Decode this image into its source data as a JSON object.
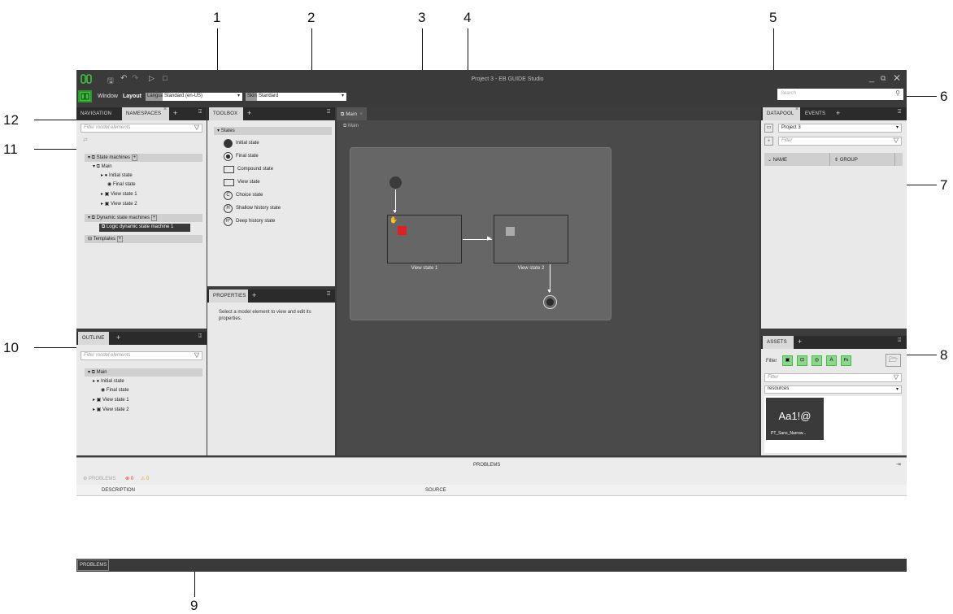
{
  "callouts": [
    "1",
    "2",
    "3",
    "4",
    "5",
    "6",
    "7",
    "8",
    "9",
    "10",
    "11",
    "12"
  ],
  "window": {
    "title": "Project 3 - EB GUIDE Studio",
    "menu_window": "Window",
    "menu_layout": "Layout",
    "language_tag": "Language",
    "language_value": "Standard (en-US)",
    "skin_tag": "Skin",
    "skin_value": "Standard",
    "search_placeholder": "Search"
  },
  "left_top": {
    "tab_navigation": "NAVIGATION",
    "tab_namespaces": "NAMESPACES",
    "filter_placeholder": "Filter model elements",
    "tree": {
      "state_machines": "State machines",
      "main": "Main",
      "initial_state": "Initial state",
      "final_state": "Final state",
      "view_state_1": "View state 1",
      "view_state_2": "View state 2",
      "dynamic_state_machines": "Dynamic state machines",
      "logic_dsm": "Logic dynamic state machine 1",
      "templates": "Templates"
    }
  },
  "outline": {
    "tab": "OUTLINE",
    "filter_placeholder": "Filter model elements",
    "main": "Main",
    "initial_state": "Initial state",
    "final_state": "Final state",
    "view_state_1": "View state 1",
    "view_state_2": "View state 2"
  },
  "toolbox": {
    "tab": "TOOLBOX",
    "section": "States",
    "items": [
      "Initial state",
      "Final state",
      "Compound state",
      "View state",
      "Choice state",
      "Shallow history state",
      "Deep history state"
    ]
  },
  "properties": {
    "tab": "PROPERTIES",
    "hint": "Select a model element to view and edit its properties."
  },
  "editor": {
    "tab": "Main",
    "breadcrumb": "Main",
    "view_state_1": "View state 1",
    "view_state_2": "View state 2"
  },
  "datapool": {
    "tab_datapool": "DATAPOOL",
    "tab_events": "EVENTS",
    "project": "Project 3",
    "filter_placeholder": "Filter",
    "col_name": "NAME",
    "col_group": "GROUP"
  },
  "assets": {
    "tab": "ASSETS",
    "filter_label": "Filter",
    "filter_placeholder": "Filter",
    "folder": "resources",
    "tile_preview": "Aa1!@",
    "tile_name": "PT_Sans_Narrow..."
  },
  "problems": {
    "header": "PROBLEMS",
    "toolbar_label": "PROBLEMS",
    "error_count": "0",
    "warning_count": "0",
    "col_description": "DESCRIPTION",
    "col_source": "SOURCE",
    "bottom_tab": "PROBLEMS"
  },
  "colors": {
    "accent_green": "#3cc33c",
    "red_marker": "#e02020"
  }
}
